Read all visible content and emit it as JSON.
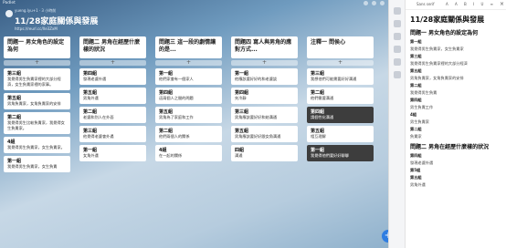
{
  "app": {
    "brand": "Padlet"
  },
  "header": {
    "subtitle": "yueng.lyu+1 · 3 小時前",
    "title": "11/28家庭關係與發展",
    "url": "https://reurl.cc/Xe3ZxM"
  },
  "columns": [
    {
      "title": "問題一 男女角色的設定為何",
      "cards": [
        {
          "title": "第三組",
          "text": "我覺得男生負責家裡的大部分經濟，女生負責家裡的家事。",
          "dark": false
        },
        {
          "title": "第五組",
          "text": "男角負責家，女角負責家的安排",
          "dark": false
        },
        {
          "title": "第二組",
          "text": "我覺得男生比較負責家，我覺得女生負責家。",
          "dark": false
        },
        {
          "title": "4組",
          "text": "我覺得男生負責家，女生負責家。",
          "dark": false
        },
        {
          "title": "第一組",
          "text": "我覺得男生負責家，女生負責",
          "dark": false
        }
      ]
    },
    {
      "title": "問題二 男角在經歷什麼樣的狀況",
      "cards": [
        {
          "title": "第四組",
          "text": "發現老婆外遇",
          "dark": false
        },
        {
          "title": "第五組",
          "text": "男角外遇",
          "dark": false
        },
        {
          "title": "第二組",
          "text": "老婆和別人在外面",
          "dark": false
        },
        {
          "title": "第三組",
          "text": "他覺得老婆會外遇",
          "dark": false
        },
        {
          "title": "第一組",
          "text": "女角外遇",
          "dark": false
        }
      ]
    },
    {
      "title": "問題三 這一段的劇情讓的是...",
      "cards": [
        {
          "title": "第一組",
          "text": "他們家會有一個家人",
          "dark": false
        },
        {
          "title": "第四組",
          "text": "這兩個人之間的問題",
          "dark": false
        },
        {
          "title": "第五組",
          "text": "男角為了家庭和工作",
          "dark": false
        },
        {
          "title": "第二組",
          "text": "他們兩個人的關係",
          "dark": false
        },
        {
          "title": "4組",
          "text": "在一起的關係",
          "dark": false
        }
      ]
    },
    {
      "title": "問題四 寫人與男角的應對方式...",
      "cards": [
        {
          "title": "第一組",
          "text": "他應該要好好的和老婆談",
          "dark": false
        },
        {
          "title": "第四組",
          "text": "先冷靜",
          "dark": false
        },
        {
          "title": "第三組",
          "text": "男角應該要好好和她溝通",
          "dark": false
        },
        {
          "title": "第五組",
          "text": "男角應該要好好跟女角溝通",
          "dark": false
        },
        {
          "title": "四組",
          "text": "溝通",
          "dark": false
        }
      ]
    },
    {
      "title": "注釋一 問侯心",
      "cards": [
        {
          "title": "第三組",
          "text": "我想他們可能需要好好溝通",
          "dark": false
        },
        {
          "title": "第二組",
          "text": "他們需要溝通",
          "dark": false
        },
        {
          "title": "第四組",
          "text": "請個性化溝通",
          "dark": true
        },
        {
          "title": "第五組",
          "text": "相互理解",
          "dark": false
        },
        {
          "title": "第一組",
          "text": "我覺得他們要好好聊聊",
          "dark": true
        }
      ]
    }
  ],
  "fab": {
    "label": "+"
  },
  "doc": {
    "font": "Sans serif",
    "title": "11/28家庭關係與發展",
    "sections": [
      {
        "heading": "問題一 男女角色的設定為何",
        "items": [
          "第一組",
          "我覺得男生負責家，女生負責家",
          "第三組",
          "我覺得男生負責家裡的大部分經濟",
          "第五組",
          "男角負責家，女角負責家的安排",
          "第二組",
          "我覺得男生負責",
          "第四組",
          "男生負責工作",
          "4組",
          "男生負責家",
          "第二組",
          "負責家"
        ]
      },
      {
        "heading": "問題二 男角在經歷什麼樣的狀況",
        "items": [
          "第四組",
          "發現老婆外遇",
          "第5組",
          "第五組",
          "男角外遇"
        ]
      }
    ]
  }
}
